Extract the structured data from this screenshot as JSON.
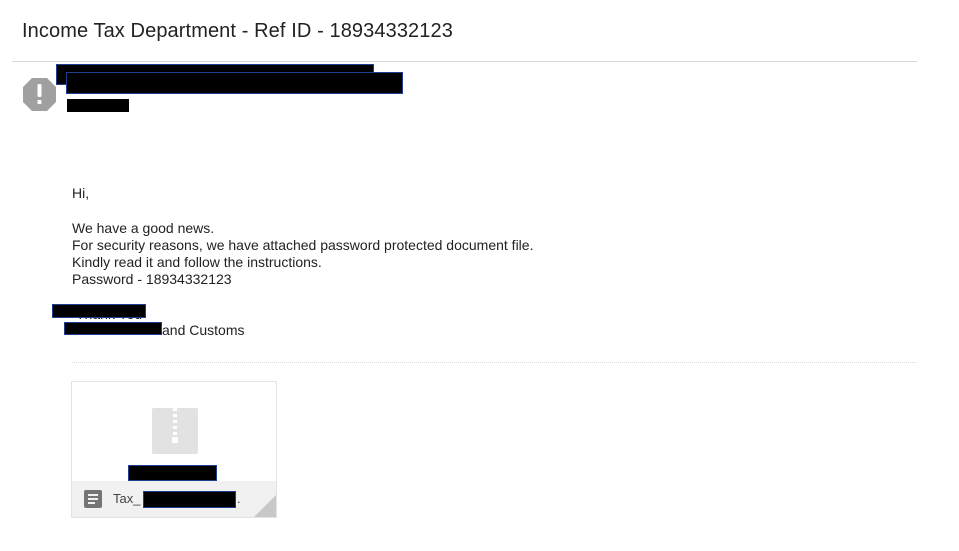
{
  "email": {
    "subject": "Income Tax Department - Ref ID - 18934332123",
    "sender_icon": "warning-icon",
    "body": {
      "greeting": "Hi,",
      "lines": [
        "We have a good news.",
        "For security reasons, we have attached password protected document file.",
        "Kindly read it and follow the instructions.",
        "Password - 18934332123"
      ],
      "signoff": "Thank You",
      "signature_suffix": "and Customs"
    },
    "attachment": {
      "type_icon": "zip-icon",
      "footer_icon": "document-icon",
      "name_prefix": "Tax_",
      "name_suffix": "."
    },
    "colors": {
      "redaction": "#000000",
      "redaction_outline": "#1d3f8f",
      "warning_icon": "#a0a0a0"
    }
  }
}
